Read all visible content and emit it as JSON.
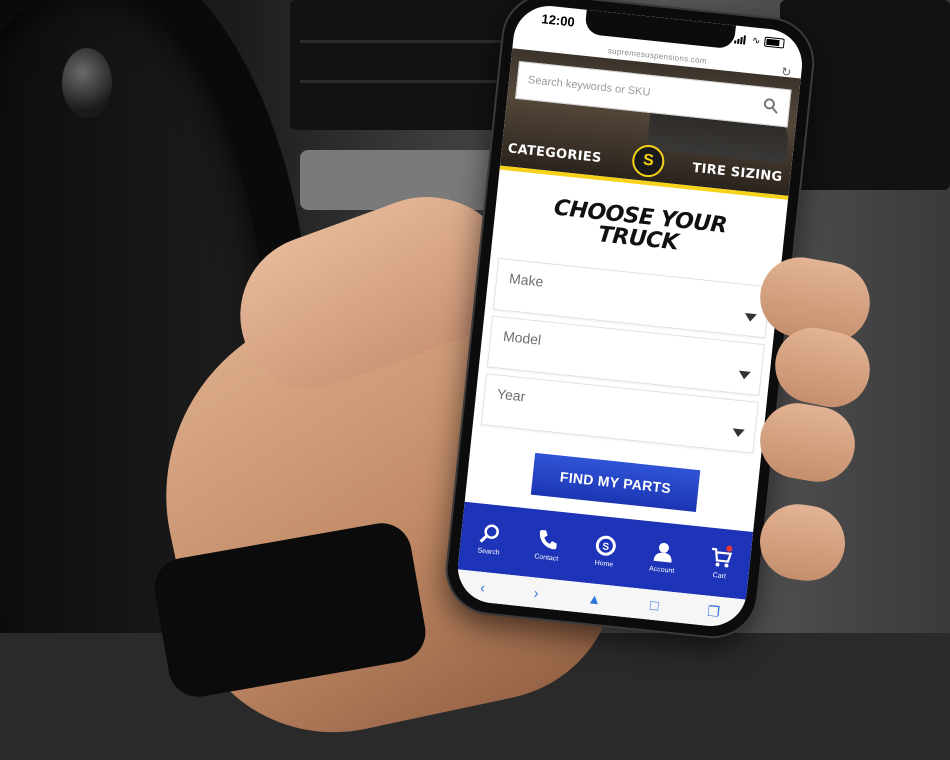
{
  "status_bar": {
    "time": "12:00"
  },
  "browser": {
    "url": "supremesuspensions.com"
  },
  "search": {
    "placeholder": "Search keywords or SKU"
  },
  "nav": {
    "categories": "CATEGORIES",
    "tire_sizing": "TIRE SIZING"
  },
  "logo_letter": "S",
  "main": {
    "heading_line1": "CHOOSE YOUR",
    "heading_line2": "TRUCK",
    "make_label": "Make",
    "model_label": "Model",
    "year_label": "Year",
    "find_button": "FIND MY PARTS"
  },
  "bottom_nav": [
    {
      "label": "Search",
      "icon": "search-icon"
    },
    {
      "label": "Contact",
      "icon": "phone-icon"
    },
    {
      "label": "Home",
      "icon": "logo-icon"
    },
    {
      "label": "Account",
      "icon": "user-icon"
    },
    {
      "label": "Cart",
      "icon": "cart-icon"
    }
  ],
  "colors": {
    "accent_yellow": "#f6d21a",
    "nav_blue": "#1d33b8",
    "button_blue": "#2f54d6"
  }
}
